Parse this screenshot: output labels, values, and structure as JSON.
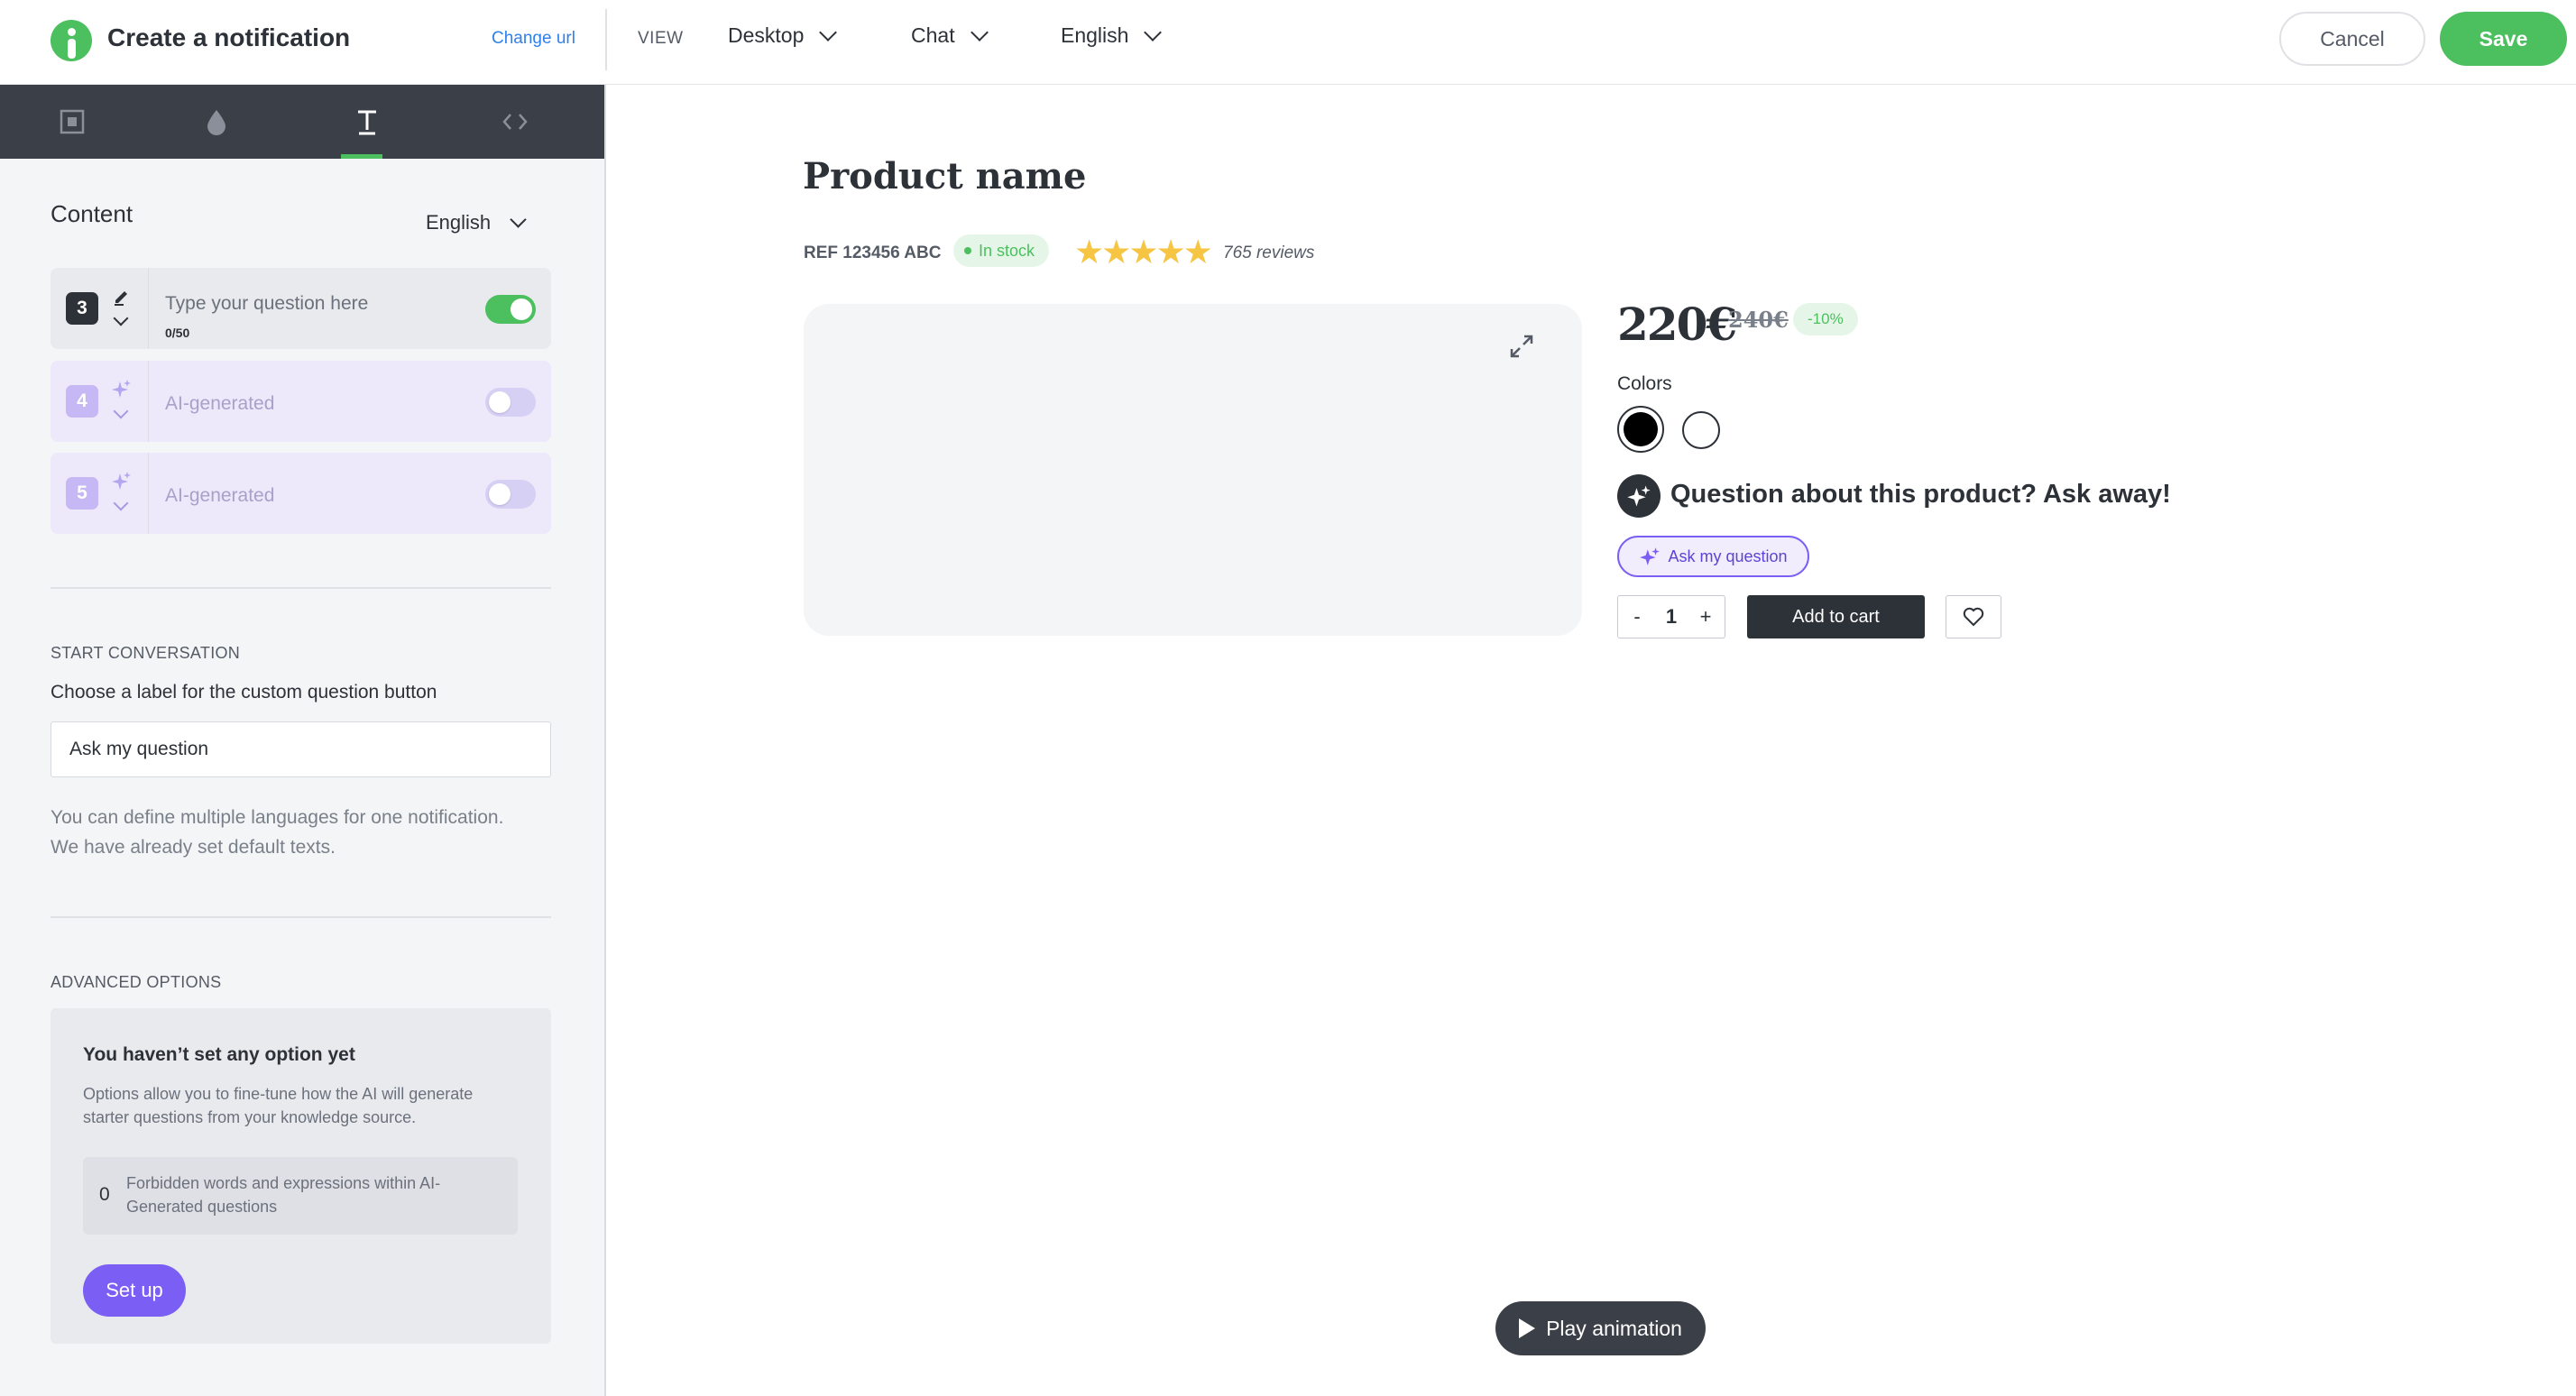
{
  "header": {
    "title": "Create a notification",
    "change_url": "Change url",
    "view_label": "VIEW",
    "device": "Desktop",
    "mode": "Chat",
    "language": "English",
    "cancel": "Cancel",
    "save": "Save"
  },
  "left_panel": {
    "tabs": [
      {
        "icon": "layout-icon",
        "active": false
      },
      {
        "icon": "color-drop-icon",
        "active": false
      },
      {
        "icon": "text-icon",
        "active": true
      },
      {
        "icon": "code-icon",
        "active": false
      }
    ],
    "content_title": "Content",
    "language": "English",
    "questions": [
      {
        "number": "3",
        "text": "Type your question here",
        "count": "0/50",
        "enabled": true,
        "type": "custom"
      },
      {
        "number": "4",
        "text": "AI-generated",
        "enabled": false,
        "type": "ai"
      },
      {
        "number": "5",
        "text": "AI-generated",
        "enabled": false,
        "type": "ai"
      }
    ],
    "start_conversation": {
      "section_label": "START CONVERSATION",
      "field_label": "Choose a label for the custom question button",
      "value": "Ask my question",
      "help_line1": "You can define multiple languages for one notification.",
      "help_line2": "We have already set default texts."
    },
    "advanced": {
      "section_label": "ADVANCED OPTIONS",
      "title": "You haven’t set any option yet",
      "description": "Options allow you to fine-tune how the AI will generate starter questions from your knowledge source.",
      "forbidden_count": "0",
      "forbidden_label": "Forbidden words and expressions within AI-Generated questions",
      "setup_button": "Set up"
    }
  },
  "preview": {
    "product_name": "Product name",
    "ref": "REF 123456 ABC",
    "stock": "In stock",
    "rating": 5,
    "stars": "★★★★★",
    "reviews": "765 reviews",
    "price": "220€",
    "old_price": "240€",
    "discount": "-10%",
    "colors_label": "Colors",
    "colors": [
      "#000000",
      "#ffffff"
    ],
    "question_prompt": "Question about this product? Ask away!",
    "ask_button": "Ask my question",
    "qty_minus": "-",
    "quantity": "1",
    "qty_plus": "+",
    "add_to_cart": "Add to cart",
    "play_animation": "Play animation"
  },
  "colors": {
    "brand_green": "#4cbf5f",
    "accent_purple": "#7b5ff5",
    "dark": "#2d3138",
    "star": "#f5c543"
  }
}
